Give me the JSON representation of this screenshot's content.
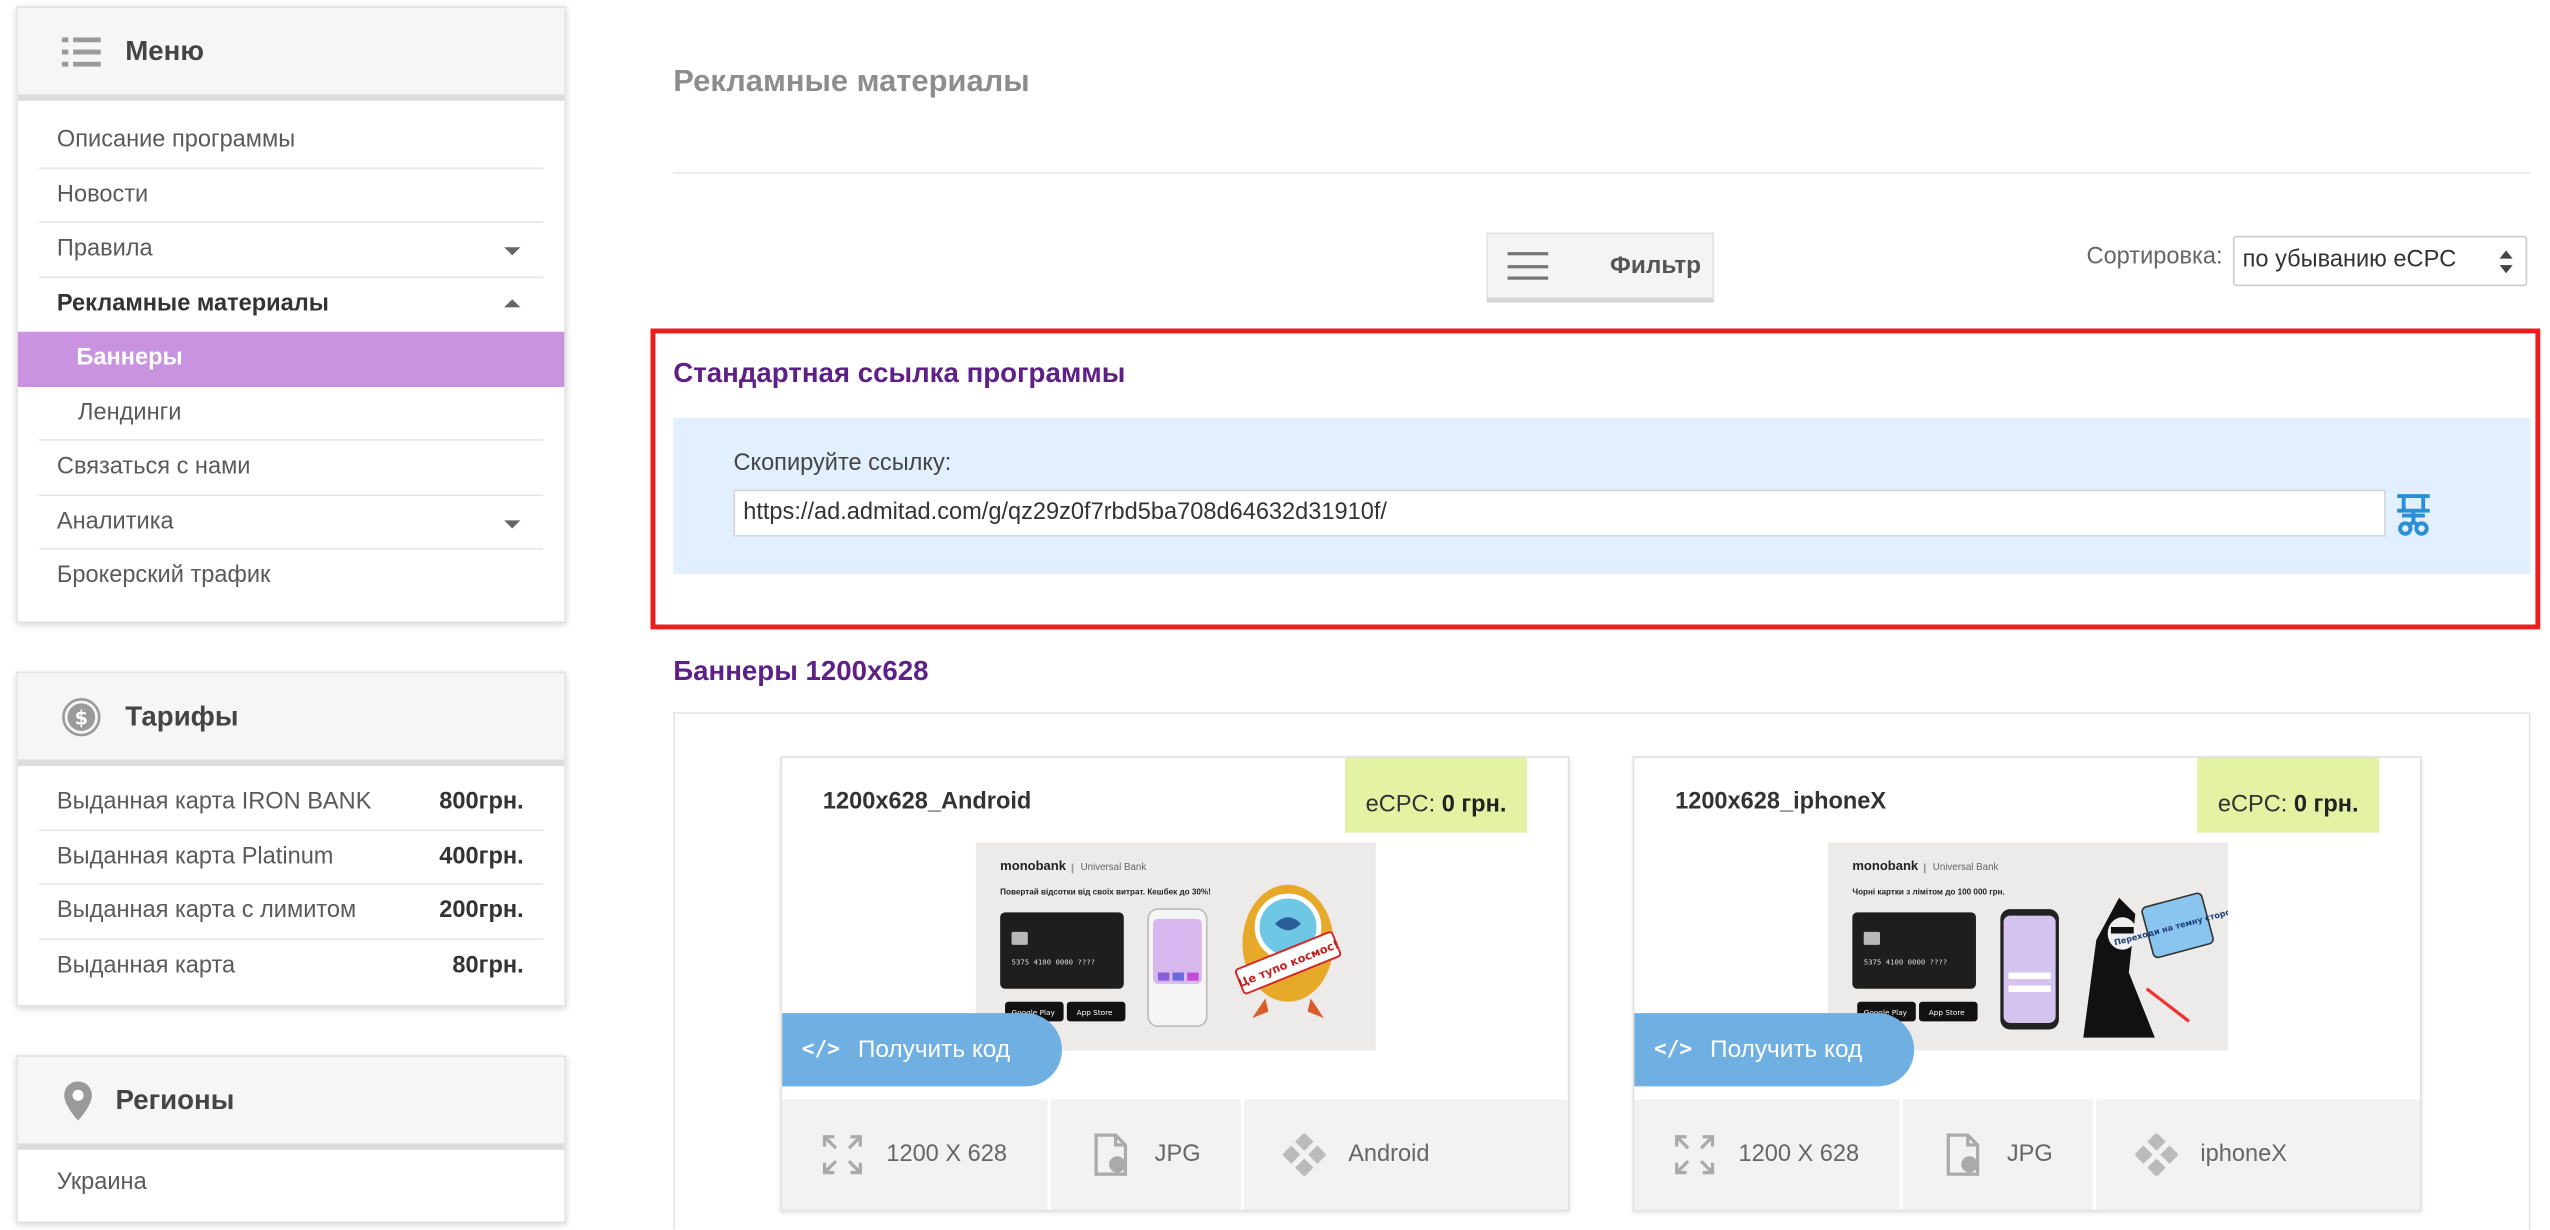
{
  "menu": {
    "title": "Меню",
    "items": [
      {
        "label": "Описание программы"
      },
      {
        "label": "Новости"
      },
      {
        "label": "Правила"
      },
      {
        "label": "Рекламные материалы"
      },
      {
        "label": "Баннеры"
      },
      {
        "label": "Лендинги"
      },
      {
        "label": "Связаться с нами"
      },
      {
        "label": "Аналитика"
      },
      {
        "label": "Брокерский трафик"
      }
    ]
  },
  "tariffs": {
    "title": "Тарифы",
    "rows": [
      {
        "name": "Выданная карта IRON BANK",
        "price": "800грн."
      },
      {
        "name": "Выданная карта Platinum",
        "price": "400грн."
      },
      {
        "name": "Выданная карта с лимитом",
        "price": "200грн."
      },
      {
        "name": "Выданная карта",
        "price": "80грн."
      }
    ]
  },
  "regions": {
    "title": "Регионы",
    "items": [
      {
        "label": "Украина"
      }
    ]
  },
  "main": {
    "page_title": "Рекламные материалы",
    "filter_label": "Фильтр",
    "sort_label": "Сортировка:",
    "sort_value": "по убыванию eCPC",
    "standard_link": {
      "title": "Стандартная ссылка программы",
      "copy_label": "Скопируйте ссылку:",
      "url": "https://ad.admitad.com/g/qz29z0f7rbd5ba708d64632d31910f/"
    },
    "banners_section_title": "Баннеры 1200x628",
    "banners": [
      {
        "title": "1200x628_Android",
        "ecpc_label": "eCPC:",
        "ecpc_value": "0 грн.",
        "get_code_tag": "</>",
        "get_code_label": "Получить код",
        "size": "1200 X 628",
        "format": "JPG",
        "platform": "Android",
        "preview": {
          "brand": "monobank",
          "brand_sub": "Universal Bank",
          "headline": "Повертай відсотки від своїх витрат. Кешбек до 30%!",
          "sticker": "Це тупо космос!"
        }
      },
      {
        "title": "1200x628_iphoneX",
        "ecpc_label": "eCPC:",
        "ecpc_value": "0 грн.",
        "get_code_tag": "</>",
        "get_code_label": "Получить код",
        "size": "1200 X 628",
        "format": "JPG",
        "platform": "iphoneX",
        "preview": {
          "brand": "monobank",
          "brand_sub": "Universal Bank",
          "headline": "Чорні картки з лімітом до 100 000 грн.",
          "sticker": "Переходи на темну сторону"
        }
      }
    ]
  },
  "colors": {
    "accent_purple": "#5e1f87",
    "active_menu": "#c993e0",
    "get_code_blue": "#6fafe2",
    "ecpc_bg": "#e3f2a3",
    "highlight_red": "#ee1c1c"
  }
}
